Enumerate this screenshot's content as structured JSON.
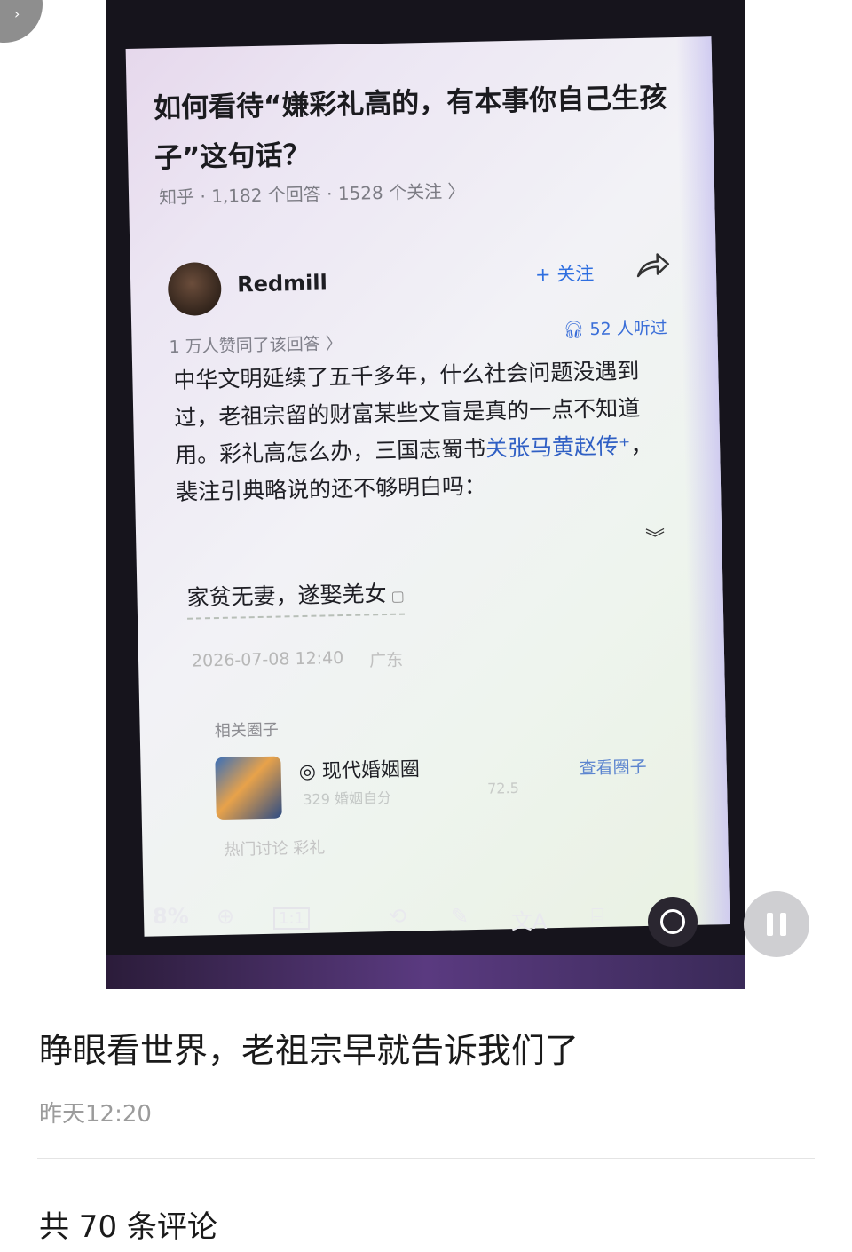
{
  "photo": {
    "question": {
      "title": "如何看待“嫌彩礼高的，有本事你自己生孩子”这句话？",
      "meta": "知乎 · 1,182 个回答 · 1528 个关注 〉"
    },
    "answer": {
      "author": "Redmill",
      "follow_label": "+ 关注",
      "likes": "1 万人赞同了该回答 〉",
      "listened": "52 人听过",
      "body_part1": "中华文明延续了五千多年，什么社会问题没遇到过，老祖宗留的财富某些文盲是真的一点不知道用。彩礼高怎么办，三国志蜀书",
      "body_link": "关张马黄赵传⁺",
      "body_part2": "，裴注引典略说的还不够明白吗：",
      "expand_icon": "chevron-double-down-icon",
      "quote": "家贫无妻，遂娶羌女",
      "timestamp": "2026-07-08 12:40",
      "location": "广东"
    },
    "circle": {
      "section_label": "相关圈子",
      "name": "◎ 现代婚姻圈",
      "members": "329 婚姻自分",
      "count": "72.5",
      "view_label": "查看圈子",
      "tags": "热门讨论  彩礼"
    },
    "viewer_toolbar": {
      "zoom": "8%",
      "items": [
        "zoom-in-icon",
        "actual-size-icon",
        "rotate-icon",
        "edit-icon",
        "translate-icon",
        "text-recognize-icon",
        "share-icon"
      ]
    }
  },
  "caption": "睁眼看世界，老祖宗早就告诉我们了",
  "post_time": "昨天12:20",
  "comments_count": "共 70 条评论"
}
